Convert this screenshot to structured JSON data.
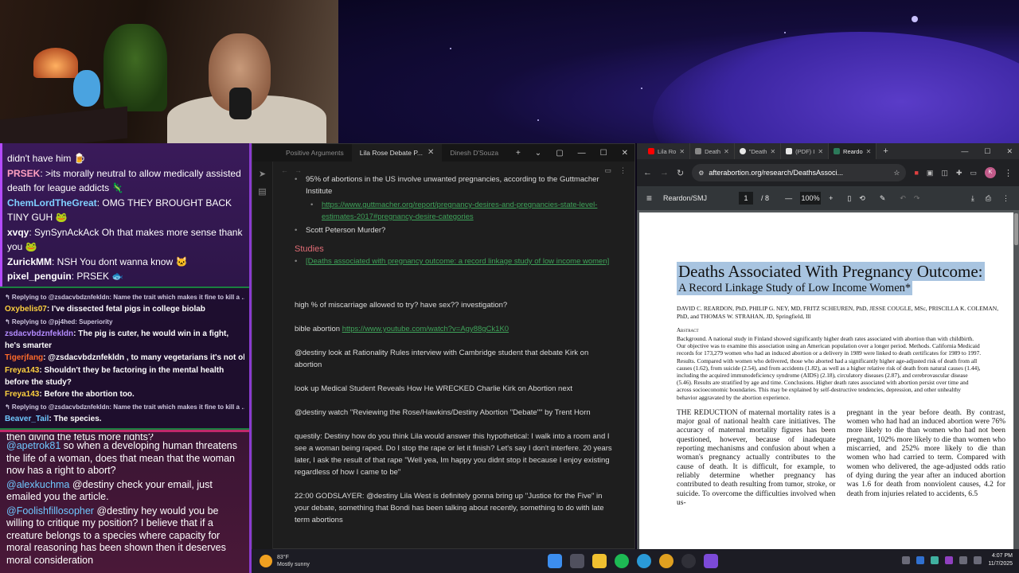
{
  "chat": {
    "lines": [
      {
        "user": "",
        "text": "didn't have him 🍺",
        "color": "#ffffff"
      },
      {
        "user": "PRSEK",
        "text": ": >its morally neutral to allow medically assisted death for league addicts 🦎",
        "color": "#ffa0c0"
      },
      {
        "user": "ChemLordTheGreat",
        "text": ": OMG THEY BROUGHT BACK TINY GUH 🐸",
        "color": "#7fd0ff"
      },
      {
        "user": "xvqy",
        "text": ": SynSynAckAck Oh that makes more sense thank you 🐸",
        "color": "#ffffff"
      },
      {
        "user": "ZurickMM",
        "text": ": NSH You dont wanna know 🐱",
        "color": "#ffffff"
      },
      {
        "user": "pixel_penguin",
        "text": ": PRSEK 🐟",
        "color": "#ffffff"
      }
    ]
  },
  "highlight": {
    "items": [
      {
        "kind": "reply",
        "text": "↰ Replying to @zsdacvbdznfekldn: Name the trait which makes it fine to kill a …"
      },
      {
        "kind": "msg",
        "user": "Oxybelis07",
        "text": ": I've dissected fetal pigs in college biolab",
        "color": "#ffd23f"
      },
      {
        "kind": "reply",
        "text": "↰ Replying to @pj4hed: Superiority"
      },
      {
        "kind": "msg",
        "user": "zsdacvbdznfekldn",
        "text": ": The pig is cuter, he would win in a fight, he's smarter",
        "color": "#b48cff"
      },
      {
        "kind": "msg",
        "user": "Tigerjfang",
        "text": ": @zsdacvbdznfekldn , to many vegetarians it's not ok",
        "color": "#ff6a2a"
      },
      {
        "kind": "msg",
        "user": "Freya143",
        "text": ": Shouldn't they be factoring in the mental health before the study?",
        "color": "#ffd23f"
      },
      {
        "kind": "msg",
        "user": "Freya143",
        "text": ": Before the abortion too.",
        "color": "#ffd23f"
      },
      {
        "kind": "reply",
        "text": "↰ Replying to @zsdacvbdznfekldn: Name the trait which makes it fine to kill a …"
      },
      {
        "kind": "msg",
        "user": "Beaver_Tail",
        "text": ": The species.",
        "color": "#6fc8ff"
      }
    ]
  },
  "lower_chat": {
    "cut_line": "then giving the fetus more rights?",
    "lines": [
      {
        "user": "@apetrok81",
        "text": " so when a developing human threatens the life of a woman, does that mean that the woman now has a right to abort?"
      },
      {
        "user": "@alexkuchma",
        "text": " @destiny check your email, just emailed you the article."
      },
      {
        "user": "@Foolishfillosopher",
        "text": " @destiny hey would you be willing to critique my position? I believe that if a creature belongs to a species where capacity for moral reasoning has been shown then it deserves moral consideration"
      }
    ]
  },
  "notes": {
    "tabs": [
      {
        "label": "Positive Arguments",
        "active": false
      },
      {
        "label": "Lila Rose Debate P...",
        "active": true
      },
      {
        "label": "Dinesh D'Souza",
        "active": false
      }
    ],
    "line1": "95% of abortions in the US involve unwanted pregnancies, according to the Guttmacher Institute",
    "link1": "https://www.guttmacher.org/report/pregnancy-desires-and-pregnancies-state-level-estimates-2017#pregnancy-desire-categories",
    "line2": "Scott Peterson Murder?",
    "studies_heading": "Studies",
    "study_link": "[Deaths associated with pregnancy outcome: a record linkage study of low income women]",
    "para1": "high % of miscarriage allowed to try? have sex?? investigation?",
    "para2_text": "bible abortion ",
    "para2_link": "https://www.youtube.com/watch?v=Agy88gCk1K0",
    "para3": "@destiny look at Rationality Rules interview with Cambridge student that debate Kirk on abortion",
    "para4": "look up Medical Student Reveals How He WRECKED Charlie Kirk on Abortion next",
    "para5": "@destiny watch \"Reviewing the Rose/Hawkins/Destiny Abortion \"Debate\"\" by Trent Horn",
    "para6": "questily: Destiny how do you think Lila would answer this hypothetical: I walk into a room and I see a woman being raped. Do I stop the rape or let it finish? Let's say I don't interfere. 20 years later, I ask the result of that rape \"Well yea, Im happy you didnt stop it because I enjoy existing regardless of how I came to be\"",
    "para7": "22:00 GODSLAYER: @destiny Lila West is definitely gonna bring up ''Justice for the Five\" in your debate, something that Bondi has been talking about recently, something to do with late term abortions"
  },
  "browser": {
    "tabs": [
      {
        "label": "Lila Ro",
        "color": "#ff0000",
        "active": false
      },
      {
        "label": "Death",
        "color": "#888888",
        "active": false
      },
      {
        "label": "\"Death",
        "color": "#e8e8e8",
        "active": false
      },
      {
        "label": "(PDF) I",
        "color": "#e8e8e8",
        "active": false
      },
      {
        "label": "Reardo",
        "color": "#2c7a5a",
        "active": true
      }
    ],
    "url": "afterabortion.org/research/DeathsAssoci...",
    "pdf": {
      "name": "Reardon/SMJ",
      "page": "1",
      "pages": "/  8",
      "zoom": "100%",
      "title": "Deaths Associated With Pregnancy Outcome:",
      "subtitle": "A Record Linkage Study of Low Income Women*",
      "authors": "DAVID C. REARDON, PhD, PHILIP G. NEY, MD, FRITZ SCHEUREN, PhD, JESSE COUGLE, MSc, PRISCILLA K. COLEMAN, PhD, and THOMAS W. STRAHAN, JD, Springfield, Ill",
      "abstract_label": "Abstract",
      "abstract": "Background. A national study in Finland showed significantly higher death rates associated with abortion than with childbirth. Our objective was to examine this association using an American population over a longer period. Methods. California Medicaid records for 173,279 women who had an induced abortion or a delivery in 1989 were linked to death certificates for 1989 to 1997. Results. Compared with women who delivered, those who aborted had a significantly higher age-adjusted risk of death from all causes (1.62), from suicide (2.54), and from accidents (1.82), as well as a higher relative risk of death from natural causes (1.44), including the acquired immunodeficiency syndrome (AIDS) (2.18), circulatory diseases (2.87), and cerebrovascular disease (5.46). Results are stratified by age and time. Conclusions. Higher death rates associated with abortion persist over time and across socioeconomic boundaries. This may be explained by self-destructive tendencies, depression, and other unhealthy behavior aggravated by the abortion experience.",
      "col1": "THE REDUCTION of maternal mortality rates is a major goal of national health care initiatives. The accuracy of maternal mortality figures has been questioned, however, because of inadequate reporting mechanisms and confusion about when a woman's pregnancy actually contributes to the cause of death. It is difficult, for example, to reliably determine whether pregnancy has contributed to death resulting from tumor, stroke, or suicide. To overcome the difficulties involved when us-",
      "col2": "pregnant in the year before death. By contrast, women who had had an induced abortion were 76% more likely to die than women who had not been pregnant, 102% more likely to die than women who miscarried, and 252% more likely to die than women who had carried to term. Compared with women who delivered, the age-adjusted odds ratio of dying during the year after an induced abortion was 1.6 for death from nonviolent causes, 4.2 for death from injuries related to accidents, 6.5"
    }
  },
  "taskbar": {
    "temp": "83°F",
    "weather": "Mostly sunny",
    "time": "4:07 PM",
    "date": "11/7/2025"
  }
}
